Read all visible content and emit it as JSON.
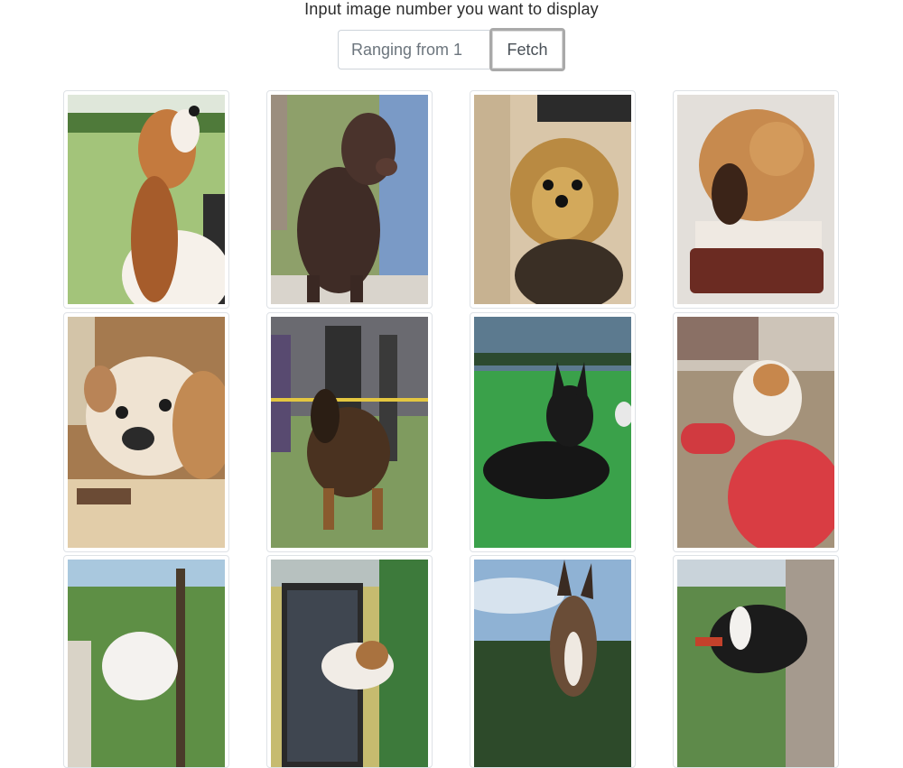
{
  "prompt": "Input image number you want to display",
  "search": {
    "placeholder": "Ranging from 1"
  },
  "fetch_label": "Fetch",
  "images": [
    {
      "subject": "cavalier-spaniel"
    },
    {
      "subject": "brown-poodle"
    },
    {
      "subject": "yorkie"
    },
    {
      "subject": "sleeping-dog"
    },
    {
      "subject": "bulldog"
    },
    {
      "subject": "german-shepherd"
    },
    {
      "subject": "black-shepherd"
    },
    {
      "subject": "jack-russell-ball"
    },
    {
      "subject": "white-dog-park"
    },
    {
      "subject": "puppy-gate"
    },
    {
      "subject": "husky-sky"
    },
    {
      "subject": "boston-terrier"
    }
  ]
}
